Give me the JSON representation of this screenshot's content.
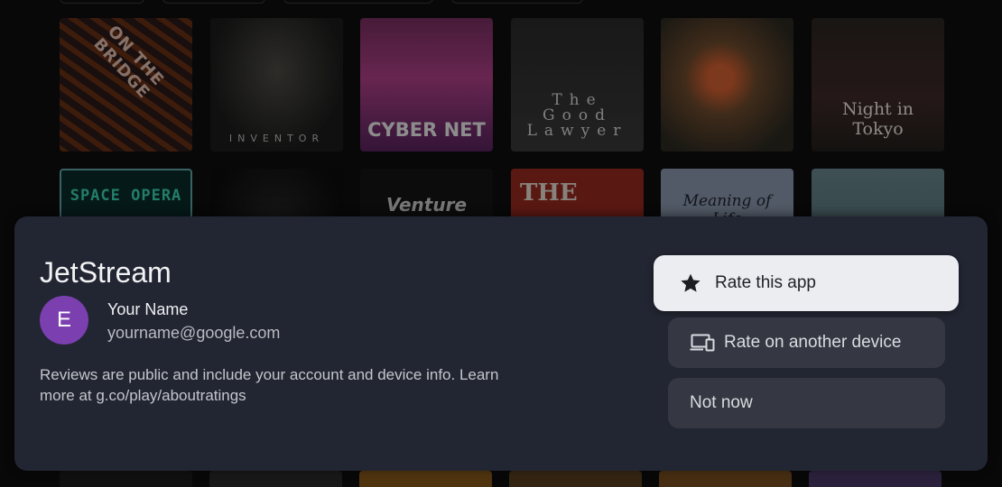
{
  "background": {
    "posters_row1": [
      {
        "title": "ON THE BRIDGE"
      },
      {
        "title": "INVENTOR"
      },
      {
        "title": "CYBER NET"
      },
      {
        "title": "The\nGood\nLawyer"
      },
      {
        "title": ""
      },
      {
        "title": "Night in Tokyo"
      }
    ],
    "posters_row2": [
      {
        "title": "SPACE OPERA"
      },
      {
        "title": ""
      },
      {
        "title": "Venture"
      },
      {
        "title": "THE"
      },
      {
        "title": "Meaning of Life"
      },
      {
        "title": ""
      }
    ]
  },
  "dialog": {
    "app_name": "JetStream",
    "avatar_initial": "E",
    "user_name": "Your Name",
    "user_email": "yourname@google.com",
    "disclaimer": "Reviews are public and include your account and device info. Learn more at g.co/play/aboutratings",
    "buttons": {
      "rate": {
        "label": "Rate this app",
        "icon": "star-icon"
      },
      "rate_other_device": {
        "label": "Rate on another device",
        "icon": "devices-icon"
      },
      "not_now": {
        "label": "Not now"
      }
    }
  },
  "colors": {
    "dialog_bg": "#222632",
    "avatar": "#7b3fb0",
    "primary_button": "#ecedf1",
    "secondary_button": "#353842"
  }
}
